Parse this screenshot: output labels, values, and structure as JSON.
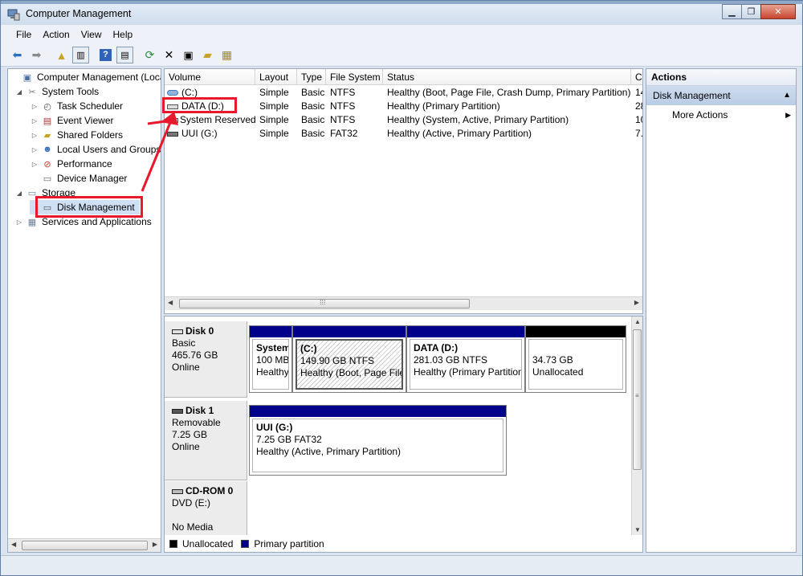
{
  "window": {
    "title": "Computer Management"
  },
  "menu": [
    "File",
    "Action",
    "View",
    "Help"
  ],
  "toolbar_icons": [
    "back-icon",
    "forward-icon",
    "up-folder-icon",
    "show-hide-tree-icon",
    "help-icon",
    "show-hide-action-pane-icon",
    "refresh-icon",
    "delete-icon",
    "properties-icon",
    "open-icon",
    "rescan-disks-icon"
  ],
  "tree": {
    "items": [
      {
        "label": "Computer Management (Local",
        "level": 0,
        "expander": "",
        "icon": "computer-management-icon"
      },
      {
        "label": "System Tools",
        "level": 1,
        "expander": "◢",
        "icon": "tools-icon"
      },
      {
        "label": "Task Scheduler",
        "level": 2,
        "expander": "▷",
        "icon": "clock-icon"
      },
      {
        "label": "Event Viewer",
        "level": 2,
        "expander": "▷",
        "icon": "event-viewer-icon"
      },
      {
        "label": "Shared Folders",
        "level": 2,
        "expander": "▷",
        "icon": "shared-folders-icon"
      },
      {
        "label": "Local Users and Groups",
        "level": 2,
        "expander": "▷",
        "icon": "users-icon"
      },
      {
        "label": "Performance",
        "level": 2,
        "expander": "▷",
        "icon": "performance-icon"
      },
      {
        "label": "Device Manager",
        "level": 2,
        "expander": "",
        "icon": "device-manager-icon"
      },
      {
        "label": "Storage",
        "level": 1,
        "expander": "◢",
        "icon": "storage-icon"
      },
      {
        "label": "Disk Management",
        "level": 2,
        "expander": "",
        "icon": "disk-management-icon"
      },
      {
        "label": "Services and Applications",
        "level": 1,
        "expander": "▷",
        "icon": "services-icon"
      }
    ]
  },
  "volumes": {
    "columns": [
      "Volume",
      "Layout",
      "Type",
      "File System",
      "Status",
      "C"
    ],
    "rows": [
      {
        "volume": "(C:)",
        "layout": "Simple",
        "type": "Basic",
        "fs": "NTFS",
        "status": "Healthy (Boot, Page File, Crash Dump, Primary Partition)",
        "cap": "14"
      },
      {
        "volume": "DATA (D:)",
        "layout": "Simple",
        "type": "Basic",
        "fs": "NTFS",
        "status": "Healthy (Primary Partition)",
        "cap": "28"
      },
      {
        "volume": "System Reserved",
        "layout": "Simple",
        "type": "Basic",
        "fs": "NTFS",
        "status": "Healthy (System, Active, Primary Partition)",
        "cap": "10"
      },
      {
        "volume": "UUI (G:)",
        "layout": "Simple",
        "type": "Basic",
        "fs": "FAT32",
        "status": "Healthy (Active, Primary Partition)",
        "cap": "7."
      }
    ]
  },
  "disks": [
    {
      "name": "Disk 0",
      "kind": "Basic",
      "size": "465.76 GB",
      "state": "Online",
      "partitions": [
        {
          "title": "System",
          "line1": "100 MB",
          "line2": "Healthy",
          "bar": "primary",
          "hatch": false
        },
        {
          "title": "(C:)",
          "line1": "149.90 GB NTFS",
          "line2": "Healthy (Boot, Page File",
          "bar": "primary",
          "hatch": true
        },
        {
          "title": "DATA  (D:)",
          "line1": "281.03 GB NTFS",
          "line2": "Healthy (Primary Partition",
          "bar": "primary",
          "hatch": false
        },
        {
          "title": "",
          "line1": "34.73 GB",
          "line2": "Unallocated",
          "bar": "unalloc",
          "hatch": false
        }
      ]
    },
    {
      "name": "Disk 1",
      "kind": "Removable",
      "size": "7.25 GB",
      "state": "Online",
      "partitions": [
        {
          "title": "UUI  (G:)",
          "line1": "7.25 GB FAT32",
          "line2": "Healthy (Active, Primary Partition)",
          "bar": "primary",
          "hatch": false
        }
      ]
    },
    {
      "name": "CD-ROM 0",
      "kind": "DVD (E:)",
      "size": "",
      "state": "No Media",
      "partitions": []
    }
  ],
  "legend": [
    {
      "label": "Unallocated",
      "color": "#000000"
    },
    {
      "label": "Primary partition",
      "color": "#00008b"
    }
  ],
  "actions": {
    "header": "Actions",
    "section": "Disk Management",
    "items": [
      "More Actions"
    ]
  },
  "colors": {
    "annotation": "#e8192c",
    "primary_partition": "#00008b",
    "unallocated": "#000000"
  }
}
